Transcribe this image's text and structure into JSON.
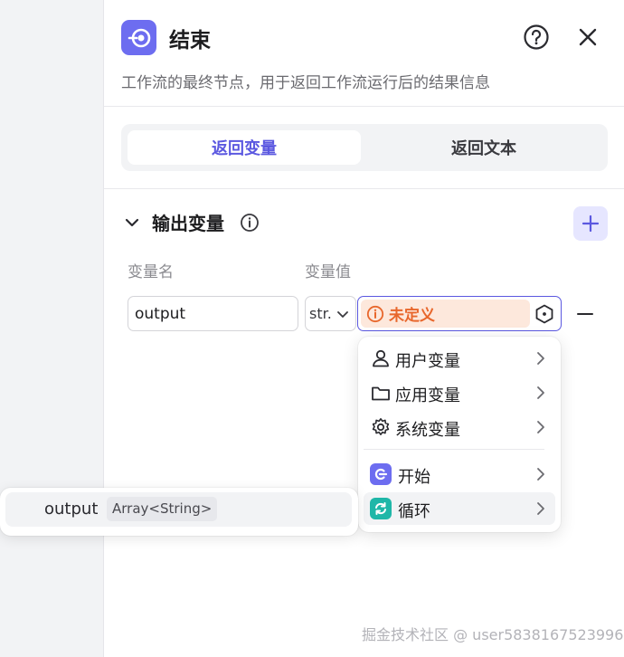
{
  "panel": {
    "title": "结束",
    "description": "工作流的最终节点，用于返回工作流运行后的结果信息",
    "icons": {
      "node": "end-node-icon",
      "help": "help-circle-icon",
      "close": "close-icon"
    },
    "accent_color": "#6d6df0"
  },
  "tabs": {
    "return_variables": "返回变量",
    "return_text": "返回文本",
    "active": "返回变量"
  },
  "output_section": {
    "title": "输出变量",
    "col_name": "变量名",
    "col_value": "变量值",
    "rows": [
      {
        "name": "output",
        "type": "str.",
        "value": "未定义"
      }
    ]
  },
  "dropdown": {
    "items": [
      {
        "label": "用户变量",
        "icon": "user-icon"
      },
      {
        "label": "应用变量",
        "icon": "folder-icon"
      },
      {
        "label": "系统变量",
        "icon": "gear-icon"
      },
      {
        "label": "开始",
        "icon": "start-node-icon",
        "color": "#6d6df0"
      },
      {
        "label": "循环",
        "icon": "loop-node-icon",
        "color": "#1fb7a8"
      }
    ]
  },
  "submenu": {
    "name": "output",
    "type": "Array<String>"
  },
  "watermark": "掘金技术社区 @ user5838167523996"
}
